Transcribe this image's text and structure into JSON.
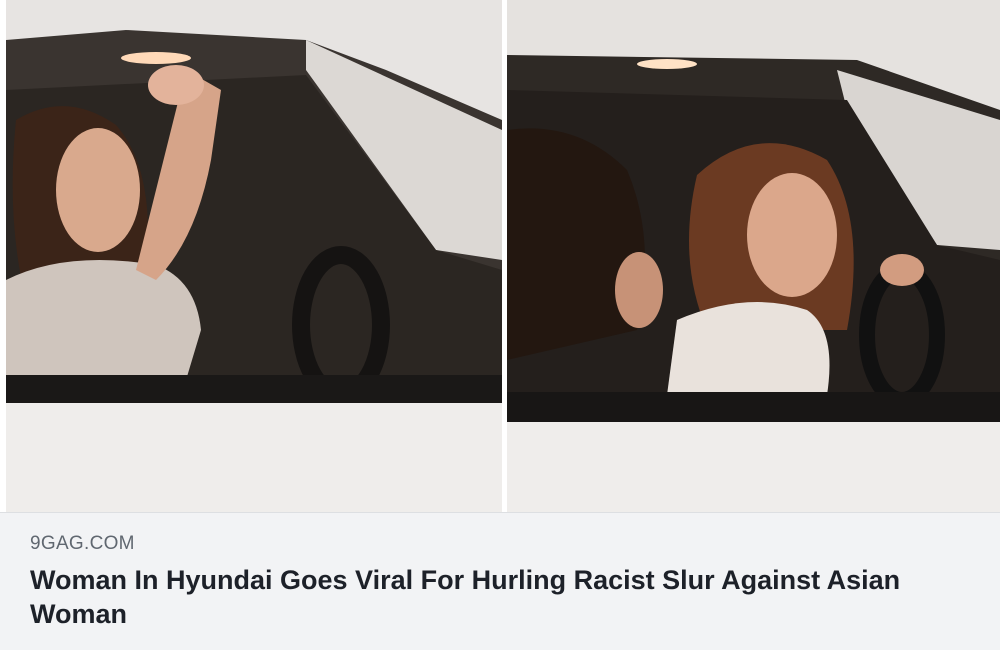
{
  "link_preview": {
    "domain": "9GAG.COM",
    "headline": "Woman In Hyundai Goes Viral For Hurling Racist Slur Against Asian Woman"
  },
  "images": [
    {
      "name": "left-photo"
    },
    {
      "name": "right-photo"
    }
  ],
  "colors": {
    "caption_bg": "#f2f3f5",
    "domain_text": "#606770",
    "headline_text": "#1d2129"
  }
}
